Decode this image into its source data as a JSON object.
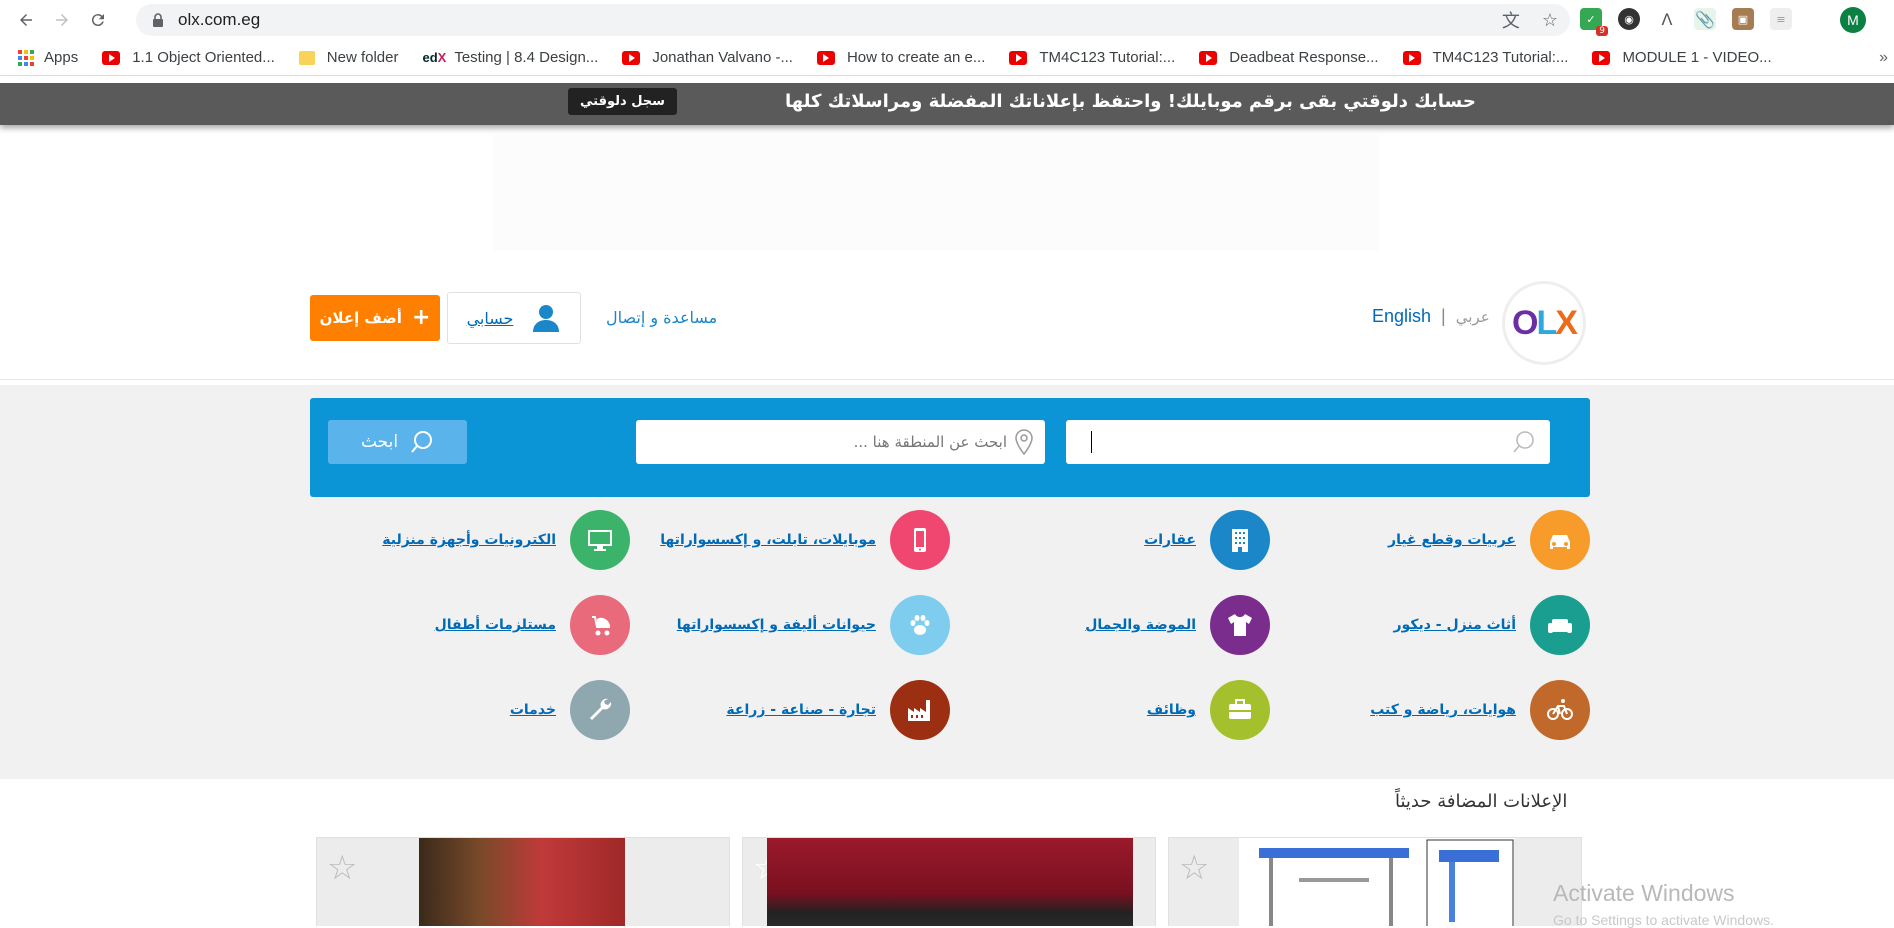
{
  "browser": {
    "url": "olx.com.eg",
    "profile_initial": "M",
    "extension_badge": "9",
    "bookmarks": [
      {
        "label": "Apps",
        "icon": "apps-grid-icon"
      },
      {
        "label": "1.1 Object Oriented...",
        "icon": "youtube-icon"
      },
      {
        "label": "New folder",
        "icon": "folder-icon"
      },
      {
        "label": "Testing | 8.4 Design...",
        "icon": "edx-icon"
      },
      {
        "label": "Jonathan Valvano -...",
        "icon": "youtube-icon"
      },
      {
        "label": "How to create an e...",
        "icon": "youtube-icon"
      },
      {
        "label": "TM4C123 Tutorial:...",
        "icon": "youtube-icon"
      },
      {
        "label": "Deadbeat Response...",
        "icon": "youtube-icon"
      },
      {
        "label": "TM4C123 Tutorial:...",
        "icon": "youtube-icon"
      },
      {
        "label": "MODULE 1 - VIDEO...",
        "icon": "youtube-icon"
      }
    ],
    "more_bookmarks": "»"
  },
  "promo": {
    "text": "حسابك دلوقتي بقى برقم موبايلك! واحتفظ بإعلاناتك المفضلة ومراسلاتك كلها",
    "button": "سجل دلوقتي"
  },
  "header": {
    "post_ad": "أضف إعلان",
    "my_account": "حسابي",
    "help": "مساعدة و إتصال",
    "lang_en": "English",
    "lang_sep": "|",
    "lang_ar": "عربي",
    "logo": {
      "o": "O",
      "l": "L",
      "x": "X"
    }
  },
  "search": {
    "keyword_placeholder": "",
    "location_placeholder": "ابحث عن المنطقة هنا ...",
    "button": "ابحث"
  },
  "categories": [
    {
      "label": "عربيات وقطع غيار",
      "icon": "car-icon",
      "color": "#f79c2a"
    },
    {
      "label": "عقارات",
      "icon": "building-icon",
      "color": "#1b87c8"
    },
    {
      "label": "موبايلات، تابلت، و إكسسواراتها",
      "icon": "mobile-icon",
      "color": "#ef476f"
    },
    {
      "label": "الكترونيات وأجهزة منزلية",
      "icon": "monitor-icon",
      "color": "#3bb36a"
    },
    {
      "label": "أثاث منزل - ديكور",
      "icon": "sofa-icon",
      "color": "#1a9e8f"
    },
    {
      "label": "الموضة والجمال",
      "icon": "tshirt-icon",
      "color": "#7b2d8e"
    },
    {
      "label": "حيوانات أليفة و إكسسواراتها",
      "icon": "paw-icon",
      "color": "#7fcdee"
    },
    {
      "label": "مستلزمات أطفال",
      "icon": "stroller-icon",
      "color": "#e96b7b"
    },
    {
      "label": "هوايات، رياضة و كتب",
      "icon": "bicycle-icon",
      "color": "#c0692b"
    },
    {
      "label": "وظائف",
      "icon": "briefcase-icon",
      "color": "#a4c12d"
    },
    {
      "label": "تجارة - صناعة - زراعة",
      "icon": "factory-icon",
      "color": "#9c2f12"
    },
    {
      "label": "خدمات",
      "icon": "wrench-icon",
      "color": "#8fa7ae"
    }
  ],
  "recent": {
    "title": "الإعلانات المضافة حديثاً"
  },
  "watermark": {
    "title": "Activate Windows",
    "subtitle": "Go to Settings to activate Windows."
  }
}
